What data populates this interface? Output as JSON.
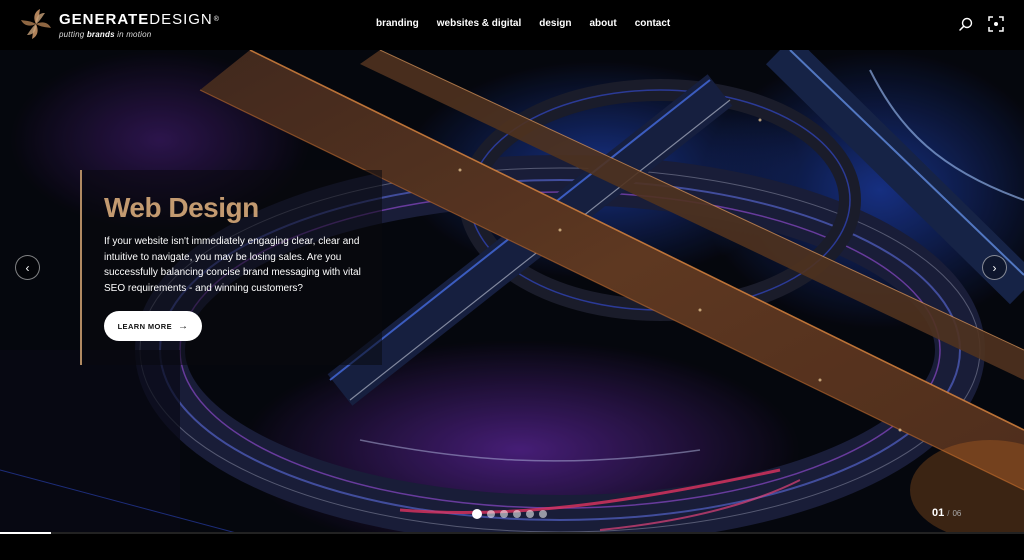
{
  "brand": {
    "name_bold": "GENERATE",
    "name_light": "DESIGN",
    "registered": "®",
    "tagline_pre": "putting ",
    "tagline_bold": "brands",
    "tagline_post": " in motion"
  },
  "nav": {
    "items": [
      {
        "label": "branding"
      },
      {
        "label": "websites & digital"
      },
      {
        "label": "design"
      },
      {
        "label": "about"
      },
      {
        "label": "contact"
      }
    ]
  },
  "header_icons": [
    "search-icon",
    "focus-frame-icon"
  ],
  "slider": {
    "title": "Web Design",
    "description": "If your website isn't immediately engaging clear, clear and intuitive to navigate, you may be losing sales. Are you successfully balancing concise brand messaging with vital SEO requirements - and winning customers?",
    "cta_label": "LEARN MORE",
    "cta_arrow": "→",
    "prev_label": "‹",
    "next_label": "›",
    "current": "01",
    "separator": "/",
    "total": "06",
    "slide_count": 6,
    "active_index": 0,
    "progress_fraction": 0.05
  },
  "colors": {
    "accent": "#c39a70",
    "background": "#000000",
    "button_bg": "#ffffff"
  }
}
